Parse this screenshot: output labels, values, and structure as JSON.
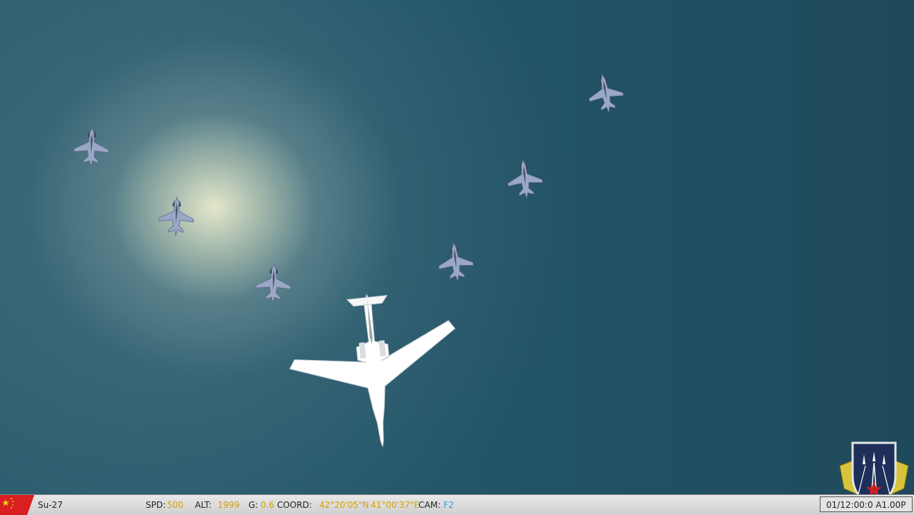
{
  "statusbar": {
    "aircraft": "Su-27",
    "spd_label": "SPD:",
    "spd_value": "500",
    "alt_label": "ALT:",
    "alt_value": "1999",
    "g_label": "G:",
    "g_value": "0.6",
    "coord_label": "COORD:",
    "coord_lat": "42°20'05\"N",
    "coord_lon": "41°00'37\"E",
    "cam_label": "CAM:",
    "cam_value": "F2",
    "clock": "01/12:00:0 A1.00P"
  },
  "colors": {
    "sea_dark": "#1f4a5c",
    "sun_glare": "#fffcd7",
    "value_text": "#d4a000",
    "camera_text": "#3a9ad9",
    "fighter": "#8e9ec0",
    "bomber": "#ffffff"
  },
  "icons": [
    "flag-icon",
    "squadron-emblem-icon",
    "fighter-jet-icon",
    "bomber-icon"
  ]
}
